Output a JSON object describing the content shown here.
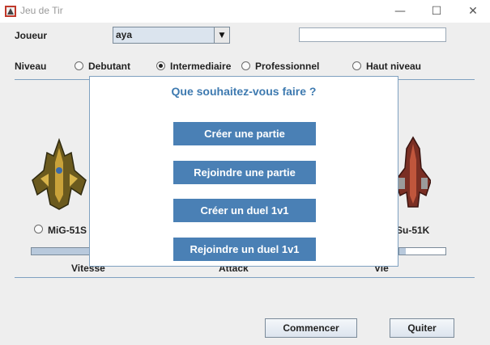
{
  "window": {
    "title": "Jeu de Tir",
    "minimize": "—",
    "maximize": "☐",
    "close": "✕"
  },
  "form": {
    "player_label": "Joueur",
    "player_value": "aya",
    "name_value": "",
    "level_label": "Niveau",
    "levels": [
      {
        "label": "Debutant",
        "selected": false
      },
      {
        "label": "Intermediaire",
        "selected": true
      },
      {
        "label": "Professionnel",
        "selected": false
      },
      {
        "label": "Haut niveau",
        "selected": false
      }
    ]
  },
  "ships": {
    "left_name": "MiG-51S",
    "right_name": "Su-51K"
  },
  "stats": {
    "speed_label": "Vitesse",
    "attack_label": "Attack",
    "life_label": "Vie",
    "speed_fill": 1.0,
    "life_fill": 0.14
  },
  "footer": {
    "start_label": "Commencer",
    "quit_label": "Quiter"
  },
  "dialog": {
    "title": "Que souhaitez-vous faire ?",
    "options": [
      "Créer une partie",
      "Rejoindre une partie",
      "Créer un duel 1v1",
      "Rejoindre un duel 1v1"
    ]
  },
  "colors": {
    "accent": "#4a80b5",
    "dialog_title": "#3e7ab0",
    "separator": "#7fa1c0"
  }
}
